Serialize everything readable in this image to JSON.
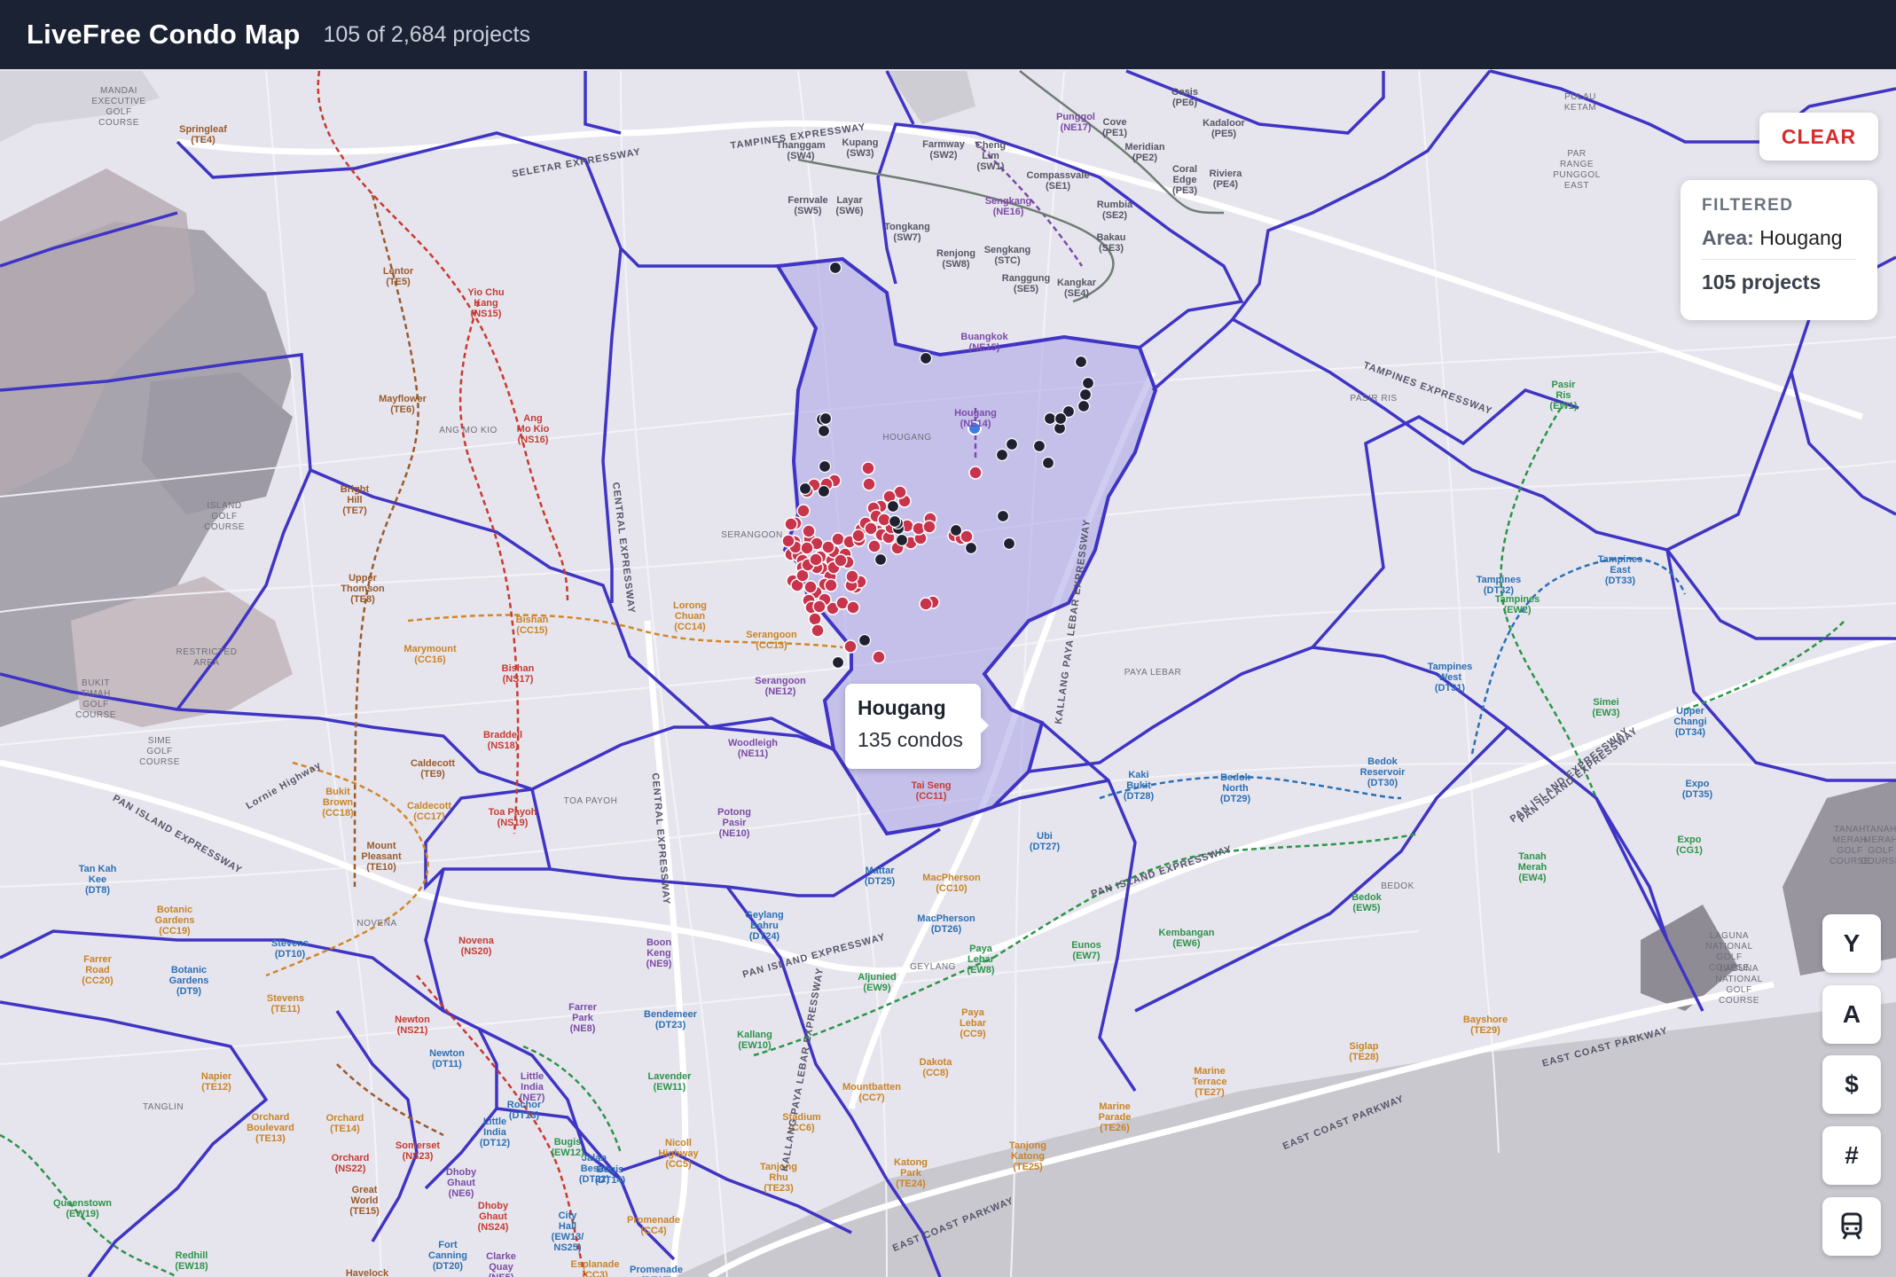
{
  "header": {
    "title": "LiveFree Condo Map",
    "count": "105 of 2,684 projects"
  },
  "controls": {
    "clear_label": "CLEAR"
  },
  "filter": {
    "heading": "FILTERED",
    "area_label": "Area:",
    "area_value": "Hougang",
    "projects": "105 projects"
  },
  "tooltip": {
    "title": "Hougang",
    "subtitle": "135 condos"
  },
  "side_buttons": [
    {
      "label": "Y",
      "icon": "year-filter"
    },
    {
      "label": "A",
      "icon": "area-filter"
    },
    {
      "label": "$",
      "icon": "price-filter"
    },
    {
      "label": "#",
      "icon": "count-filter"
    },
    {
      "label": "",
      "icon": "train-icon"
    }
  ],
  "colors": {
    "header_bg": "#1b2233",
    "boundary": "#3f34c4",
    "selected_fill": "#a7a2e8",
    "marker_red": "#c8344b",
    "marker_dark": "#1f2030",
    "clear_red": "#d62c2c"
  },
  "map_labels": {
    "stations": [
      "Springleaf\n(TE4)",
      "Lentor\n(TE5)",
      "Yio Chu\nKang\n(NS15)",
      "Mayflower\n(TE6)",
      "Ang\nMo Kio\n(NS16)",
      "Bright\nHill\n(TE7)",
      "Upper\nThomson\n(TE8)",
      "Bishan\n(CC15)",
      "Marymount\n(CC16)",
      "Bishan\n(NS17)",
      "Lorong\nChuan\n(CC14)",
      "Serangoon\n(CC13)",
      "Serangoon\n(NE12)",
      "Braddell\n(NS18)",
      "Caldecott\n(TE9)",
      "Bukit\nBrown\n(CC18)",
      "Caldecott\n(CC17)",
      "Toa Payoh\n(NS19)",
      "Mount\nPleasant\n(TE10)",
      "Woodleigh\n(NE11)",
      "Potong\nPasir\n(NE10)",
      "Tai Seng\n(CC11)",
      "Hougang\n(NE14)",
      "Buangkok\n(NE15)",
      "Thanggam\n(SW4)",
      "Kupang\n(SW3)",
      "Farmway\n(SW2)",
      "Cheng\nLim\n(SW1)",
      "Punggol\n(NE17)",
      "Cove\n(PE1)",
      "Meridian\n(PE2)",
      "Coral\nEdge\n(PE3)",
      "Riviera\n(PE4)",
      "Kadaloor\n(PE5)",
      "Oasis\n(PE6)",
      "Fernvale\n(SW5)",
      "Layar\n(SW6)",
      "Tongkang\n(SW7)",
      "Renjong\n(SW8)",
      "Sengkang\n(NE16)",
      "Compassvale\n(SE1)",
      "Rumbia\n(SE2)",
      "Bakau\n(SE3)",
      "Kangkar\n(SE4)",
      "Ranggung\n(SE5)",
      "Sengkang\n(STC)",
      "Pasir\nRis\n(EW1)",
      "Tampines\n(DT32)",
      "Tampines\nEast\n(DT33)",
      "Tampines\n(EW2)",
      "Tampines\nWest\n(DT31)",
      "Simei\n(EW3)",
      "Upper\nChangi\n(DT34)",
      "Expo\n(DT35)",
      "Expo\n(CG1)",
      "Kaki\nBukit\n(DT28)",
      "Bedok\nNorth\n(DT29)",
      "Bedok\nReservoir\n(DT30)",
      "Tanah\nMerah\n(EW4)",
      "Ubi\n(DT27)",
      "Mattar\n(DT25)",
      "MacPherson\n(CC10)",
      "MacPherson\n(DT26)",
      "Geylang\nBahru\n(DT24)",
      "Paya\nLebar\n(EW8)",
      "Eunos\n(EW7)",
      "Kembangan\n(EW6)",
      "Bedok\n(EW5)",
      "Aljunied\n(EW9)",
      "Paya\nLebar\n(CC9)",
      "Kallang\n(EW10)",
      "Dakota\n(CC8)",
      "Mountbatten\n(CC7)",
      "Stadium\n(CC6)",
      "Nicoll\nHighway\n(CC5)",
      "Tanjong\nRhu\n(TE23)",
      "Katong\nPark\n(TE24)",
      "Tanjong\nKatong\n(TE25)",
      "Marine\nParade\n(TE26)",
      "Marine\nTerrace\n(TE27)",
      "Siglap\n(TE28)",
      "Bayshore\n(TE29)",
      "Lavender\n(EW11)",
      "Bendemeer\n(DT23)",
      "Farrer\nPark\n(NE8)",
      "Boon\nKeng\n(NE9)",
      "Jalan\nBesar\n(DT22)",
      "Rochor\n(DT13)",
      "Bugis\n(EW12)",
      "Bugis\n(DT14)",
      "Promenade\n(CC4)",
      "Esplanade\n(CC3)",
      "Promenade\n(DT15)",
      "Little\nIndia\n(NE7)",
      "Little\nIndia\n(DT12)",
      "Newton\n(DT11)",
      "Newton\n(NS21)",
      "Novena\n(NS20)",
      "Stevens\n(DT10)",
      "Stevens\n(TE11)",
      "Botanic\nGardens\n(CC19)",
      "Botanic\nGardens\n(DT9)",
      "Farrer\nRoad\n(CC20)",
      "Tan Kah\nKee\n(DT8)",
      "Napier\n(TE12)",
      "Orchard\nBoulevard\n(TE13)",
      "Orchard\n(TE14)",
      "Orchard\n(NS22)",
      "Somerset\n(NS23)",
      "Dhoby\nGhaut\n(NE6)",
      "Dhoby\nGhaut\n(NS24)",
      "Great\nWorld\n(TE15)",
      "Queenstown\n(EW19)",
      "Redhill\n(EW18)",
      "Fort\nCanning\n(DT20)",
      "Clarke\nQuay\n(NE5)",
      "Havelock\n(TE16)",
      "City\nHall\n(EW13/\nNS25)"
    ],
    "areas": [
      "HOUGANG",
      "SERANGOON",
      "ANG MO KIO",
      "TOA PAYOH",
      "NOVENA",
      "TANGLIN",
      "GEYLANG",
      "BEDOK",
      "PAYA LEBAR",
      "PASIR RIS",
      "RESTRICTED\nAREA",
      "ISLAND\nGOLF\nCOURSE",
      "BUKIT\nTIMAH\nGOLF\nCOURSE",
      "SIME\nGOLF\nCOURSE",
      "MANDAI\nEXECUTIVE\nGOLF\nCOURSE",
      "LAGUNA\nNATIONAL\nGOLF\nCOURSE",
      "LAGUNA\nNATIONAL\nGOLF\nCOURSE",
      "TANAH\nMERAH\nGOLF\nCOURSE",
      "TANAH\nMERAH\nGOLF\nCOURSE",
      "PAR\nRANGE\nPUNGGOL\nEAST",
      "PULAU\nKETAM"
    ],
    "roads": [
      "TAMPINES EXPRESSWAY",
      "SELETAR EXPRESSWAY",
      "CENTRAL EXPRESSWAY",
      "CENTRAL EXPRESSWAY",
      "PAN ISLAND EXPRESSWAY",
      "PAN ISLAND EXPRESSWAY",
      "PAN ISLAND EXPRESSWAY",
      "PAN ISLAND EXPRESSWAY",
      "EAST COAST PARKWAY",
      "EAST COAST PARKWAY",
      "EAST COAST PARKWAY",
      "KALLANG PAYA LEBAR EXPRESSWAY",
      "KALLANG PAYA LEBAR EXPRESSWAY",
      "Lornie Highway",
      "PAN ISLAND EXPRESSWAY",
      "TAMPINES EXPRESSWAY"
    ]
  }
}
